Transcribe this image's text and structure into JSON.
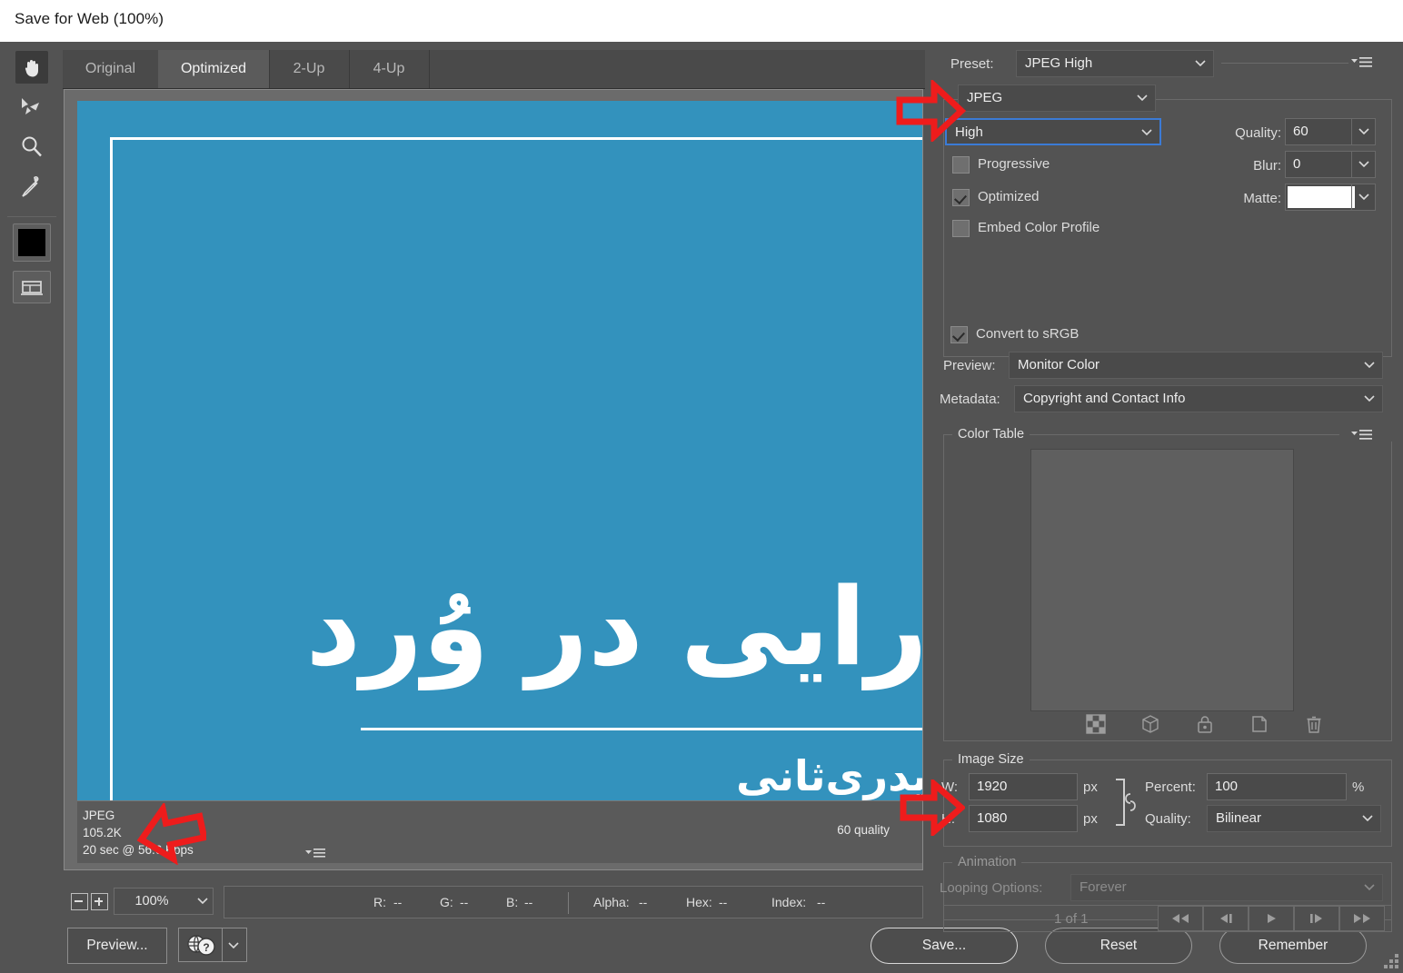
{
  "window": {
    "title": "Save for Web (100%)"
  },
  "tools": [
    {
      "name": "hand-tool",
      "icon": "hand-icon",
      "active": true
    },
    {
      "name": "slice-select-tool",
      "icon": "slice-select-icon",
      "active": false
    },
    {
      "name": "zoom-tool",
      "icon": "magnifier-icon",
      "active": false
    },
    {
      "name": "eyedropper-tool",
      "icon": "eyedropper-icon",
      "active": false
    },
    {
      "name": "foreground-color-swatch",
      "icon": "color-swatch-icon",
      "active": false,
      "color": "#000000"
    },
    {
      "name": "toggle-slices-visibility",
      "icon": "slices-visibility-icon",
      "active": false
    }
  ],
  "tabs": [
    {
      "label": "Original",
      "selected": false
    },
    {
      "label": "Optimized",
      "selected": true
    },
    {
      "label": "2-Up",
      "selected": false
    },
    {
      "label": "4-Up",
      "selected": false
    }
  ],
  "preview": {
    "background_color": "#3392bd",
    "text_line1": "رایی در وُرد",
    "text_line2": "یدری‌ثانی",
    "status": {
      "format": "JPEG",
      "filesize": "105.2K",
      "download_time": "20 sec @ 56.6 Kbps",
      "quality": "60 quality"
    }
  },
  "zoombar": {
    "zoom_out": "−",
    "zoom_in": "+",
    "zoom_level": "100%",
    "readouts": [
      {
        "label": "R:",
        "value": "--"
      },
      {
        "label": "G:",
        "value": "--"
      },
      {
        "label": "B:",
        "value": "--"
      },
      {
        "label": "Alpha:",
        "value": "--"
      },
      {
        "label": "Hex:",
        "value": "--"
      },
      {
        "label": "Index:",
        "value": "--"
      }
    ]
  },
  "buttons": {
    "preview": "Preview...",
    "save": "Save...",
    "reset": "Reset",
    "remember": "Remember"
  },
  "settings": {
    "preset_label": "Preset:",
    "preset_value": "JPEG High",
    "format_value": "JPEG",
    "compression_value": "High",
    "quality_label": "Quality:",
    "quality_value": "60",
    "blur_label": "Blur:",
    "blur_value": "0",
    "matte_label": "Matte:",
    "matte_color": "#ffffff",
    "checkboxes": [
      {
        "label": "Progressive",
        "checked": false
      },
      {
        "label": "Optimized",
        "checked": true
      },
      {
        "label": "Embed Color Profile",
        "checked": false
      }
    ],
    "convert_srgb_label": "Convert to sRGB",
    "convert_srgb_checked": true,
    "preview_label": "Preview:",
    "preview_value": "Monitor Color",
    "metadata_label": "Metadata:",
    "metadata_value": "Copyright and Contact Info"
  },
  "color_table": {
    "title": "Color Table",
    "icons": [
      "transparency-icon",
      "web-safe-cube-icon",
      "lock-icon",
      "new-color-icon",
      "delete-color-icon"
    ]
  },
  "image_size": {
    "title": "Image Size",
    "width_label": "W:",
    "width_value": "1920",
    "width_unit": "px",
    "height_label": "H:",
    "height_value": "1080",
    "height_unit": "px",
    "percent_label": "Percent:",
    "percent_value": "100",
    "percent_unit": "%",
    "quality_label": "Quality:",
    "quality_value": "Bilinear"
  },
  "animation": {
    "title": "Animation",
    "looping_label": "Looping Options:",
    "looping_value": "Forever",
    "frame_counter": "1 of 1",
    "controls": [
      "first-frame-icon",
      "previous-frame-icon",
      "play-icon",
      "next-frame-icon",
      "last-frame-icon"
    ]
  },
  "annotations": {
    "accent_color": "#ee1c1c",
    "arrows": [
      {
        "name": "arrow-to-compression-dropdown",
        "direction": "right"
      },
      {
        "name": "arrow-to-filesize",
        "direction": "left"
      },
      {
        "name": "arrow-to-image-size",
        "direction": "right"
      }
    ]
  }
}
